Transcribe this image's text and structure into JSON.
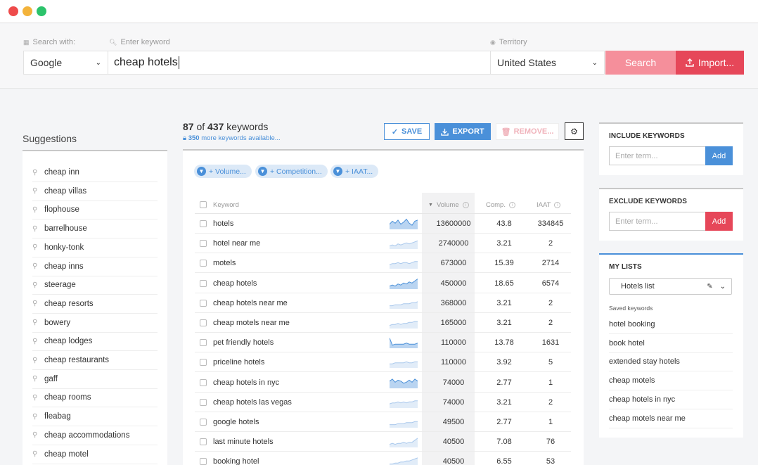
{
  "search": {
    "engine_label": "Search with:",
    "engine_value": "Google",
    "keyword_label": "Enter keyword",
    "keyword_value": "cheap hotels",
    "territory_label": "Territory",
    "territory_value": "United States",
    "search_button": "Search",
    "import_button": "Import..."
  },
  "suggestions": {
    "title": "Suggestions",
    "items": [
      "cheap inn",
      "cheap villas",
      "flophouse",
      "barrelhouse",
      "honky-tonk",
      "cheap inns",
      "steerage",
      "cheap resorts",
      "bowery",
      "cheap lodges",
      "cheap restaurants",
      "gaff",
      "cheap rooms",
      "fleabag",
      "cheap accommodations",
      "cheap motel"
    ]
  },
  "keywords": {
    "shown": "87",
    "of_text": "of",
    "total": "437",
    "unit": "keywords",
    "more_count": "350",
    "more_text": "more keywords available...",
    "save_button": "SAVE",
    "export_button": "EXPORT",
    "remove_button": "REMOVE...",
    "filters": [
      "+ Volume...",
      "+ Competition...",
      "+ IAAT..."
    ],
    "columns": {
      "keyword": "Keyword",
      "volume": "Volume",
      "comp": "Comp.",
      "iaat": "IAAT"
    },
    "rows": [
      {
        "keyword": "hotels",
        "volume": "13600000",
        "comp": "43.8",
        "iaat": "334845",
        "trend": [
          5,
          8,
          6,
          9,
          5,
          7,
          10,
          6,
          4,
          8,
          9
        ]
      },
      {
        "keyword": "hotel near me",
        "volume": "2740000",
        "comp": "3.21",
        "iaat": "2",
        "trend": [
          3,
          4,
          3,
          5,
          4,
          5,
          6,
          5,
          6,
          7,
          8
        ]
      },
      {
        "keyword": "motels",
        "volume": "673000",
        "comp": "15.39",
        "iaat": "2714",
        "trend": [
          4,
          5,
          5,
          6,
          5,
          6,
          6,
          5,
          6,
          7,
          7
        ]
      },
      {
        "keyword": "cheap hotels",
        "volume": "450000",
        "comp": "18.65",
        "iaat": "6574",
        "trend": [
          3,
          4,
          3,
          5,
          4,
          6,
          5,
          7,
          6,
          8,
          10
        ]
      },
      {
        "keyword": "cheap hotels near me",
        "volume": "368000",
        "comp": "3.21",
        "iaat": "2",
        "trend": [
          3,
          3,
          4,
          4,
          4,
          5,
          5,
          5,
          6,
          6,
          7
        ]
      },
      {
        "keyword": "cheap motels near me",
        "volume": "165000",
        "comp": "3.21",
        "iaat": "2",
        "trend": [
          3,
          4,
          4,
          5,
          4,
          5,
          5,
          6,
          6,
          7,
          7
        ]
      },
      {
        "keyword": "pet friendly hotels",
        "volume": "110000",
        "comp": "13.78",
        "iaat": "1631",
        "trend": [
          10,
          3,
          4,
          4,
          4,
          4,
          5,
          4,
          4,
          4,
          5
        ]
      },
      {
        "keyword": "priceline hotels",
        "volume": "110000",
        "comp": "3.92",
        "iaat": "5",
        "trend": [
          4,
          4,
          5,
          5,
          5,
          5,
          6,
          5,
          5,
          6,
          6
        ]
      },
      {
        "keyword": "cheap hotels in nyc",
        "volume": "74000",
        "comp": "2.77",
        "iaat": "1",
        "trend": [
          7,
          9,
          6,
          8,
          7,
          5,
          6,
          8,
          6,
          9,
          7
        ]
      },
      {
        "keyword": "cheap hotels las vegas",
        "volume": "74000",
        "comp": "3.21",
        "iaat": "2",
        "trend": [
          4,
          5,
          5,
          6,
          5,
          6,
          5,
          6,
          6,
          7,
          7
        ]
      },
      {
        "keyword": "google hotels",
        "volume": "49500",
        "comp": "2.77",
        "iaat": "1",
        "trend": [
          3,
          3,
          3,
          4,
          4,
          4,
          5,
          5,
          5,
          6,
          6
        ]
      },
      {
        "keyword": "last minute hotels",
        "volume": "40500",
        "comp": "7.08",
        "iaat": "76",
        "trend": [
          3,
          4,
          3,
          4,
          4,
          5,
          4,
          5,
          5,
          7,
          9
        ]
      },
      {
        "keyword": "booking hotel",
        "volume": "40500",
        "comp": "6.55",
        "iaat": "53",
        "trend": [
          3,
          3,
          4,
          4,
          5,
          5,
          6,
          6,
          7,
          8,
          9
        ]
      }
    ]
  },
  "include": {
    "title": "INCLUDE KEYWORDS",
    "placeholder": "Enter term...",
    "add_button": "Add"
  },
  "exclude": {
    "title": "EXCLUDE KEYWORDS",
    "placeholder": "Enter term...",
    "add_button": "Add"
  },
  "my_lists": {
    "title": "MY LISTS",
    "selected": "Hotels list",
    "saved_label": "Saved keywords",
    "items": [
      "hotel booking",
      "book hotel",
      "extended stay hotels",
      "cheap motels",
      "cheap hotels in nyc",
      "cheap motels near me"
    ]
  },
  "colors": {
    "accent_blue": "#4a90d9",
    "accent_red": "#e64759",
    "search_pink": "#f58f9b"
  }
}
